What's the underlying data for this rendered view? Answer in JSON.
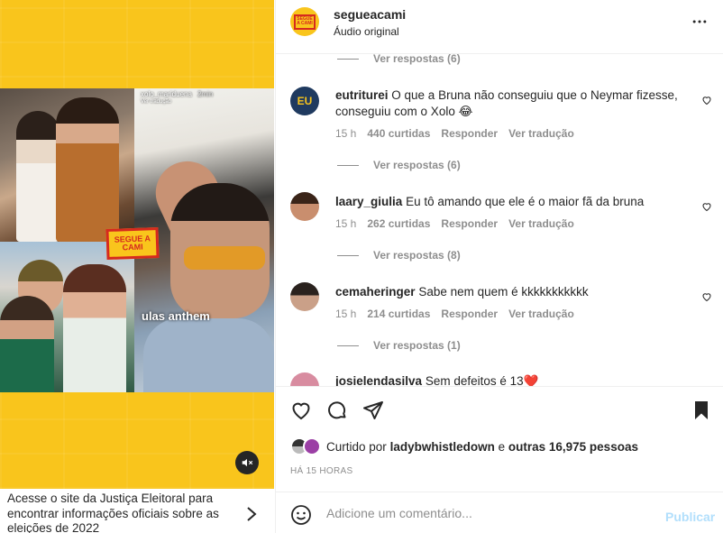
{
  "post": {
    "username": "segueacami",
    "audio": "Áudio original",
    "logo_text": "SEGUE A CAMI"
  },
  "media": {
    "story_user": "xolo_mariduena",
    "story_time": "2min",
    "story_translate": "Ver tradução",
    "overlay_text": "ulas anthem",
    "mute_icon": "muted-speaker-icon"
  },
  "banner": {
    "text": "Acesse o site da Justiça Eleitoral para encontrar informações oficiais sobre as eleições de 2022"
  },
  "comments": [
    {
      "replies": "Ver respostas (6)"
    },
    {
      "username": "eutriturei",
      "text": "O que a Bruna não conseguiu que o Neymar fizesse, conseguiu com o Xolo 😂",
      "time": "15 h",
      "likes": "440 curtidas",
      "reply": "Responder",
      "translate": "Ver tradução",
      "replies": "Ver respostas (6)"
    },
    {
      "username": "laary_giulia",
      "text": "Eu tô amando que ele é o maior fã da bruna",
      "time": "15 h",
      "likes": "262 curtidas",
      "reply": "Responder",
      "translate": "Ver tradução",
      "replies": "Ver respostas (8)"
    },
    {
      "username": "cemaheringer",
      "text": "Sabe nem quem é kkkkkkkkkkk",
      "time": "15 h",
      "likes": "214 curtidas",
      "reply": "Responder",
      "translate": "Ver tradução",
      "replies": "Ver respostas (1)"
    },
    {
      "username": "josielendasilva",
      "text": "Sem defeitos é 13❤️"
    }
  ],
  "likes": {
    "prefix": "Curtido por",
    "user": "ladybwhistledown",
    "connector": "e",
    "others": "outras 16,975 pessoas"
  },
  "timestamp": "HÁ 15 HORAS",
  "composer": {
    "placeholder": "Adicione um comentário...",
    "post_label": "Publicar"
  },
  "colors": {
    "brand_yellow": "#f9c51c",
    "brand_red": "#d62a1e",
    "muted_text": "#8e8e8e",
    "post_button_disabled": "#b2dffc"
  }
}
